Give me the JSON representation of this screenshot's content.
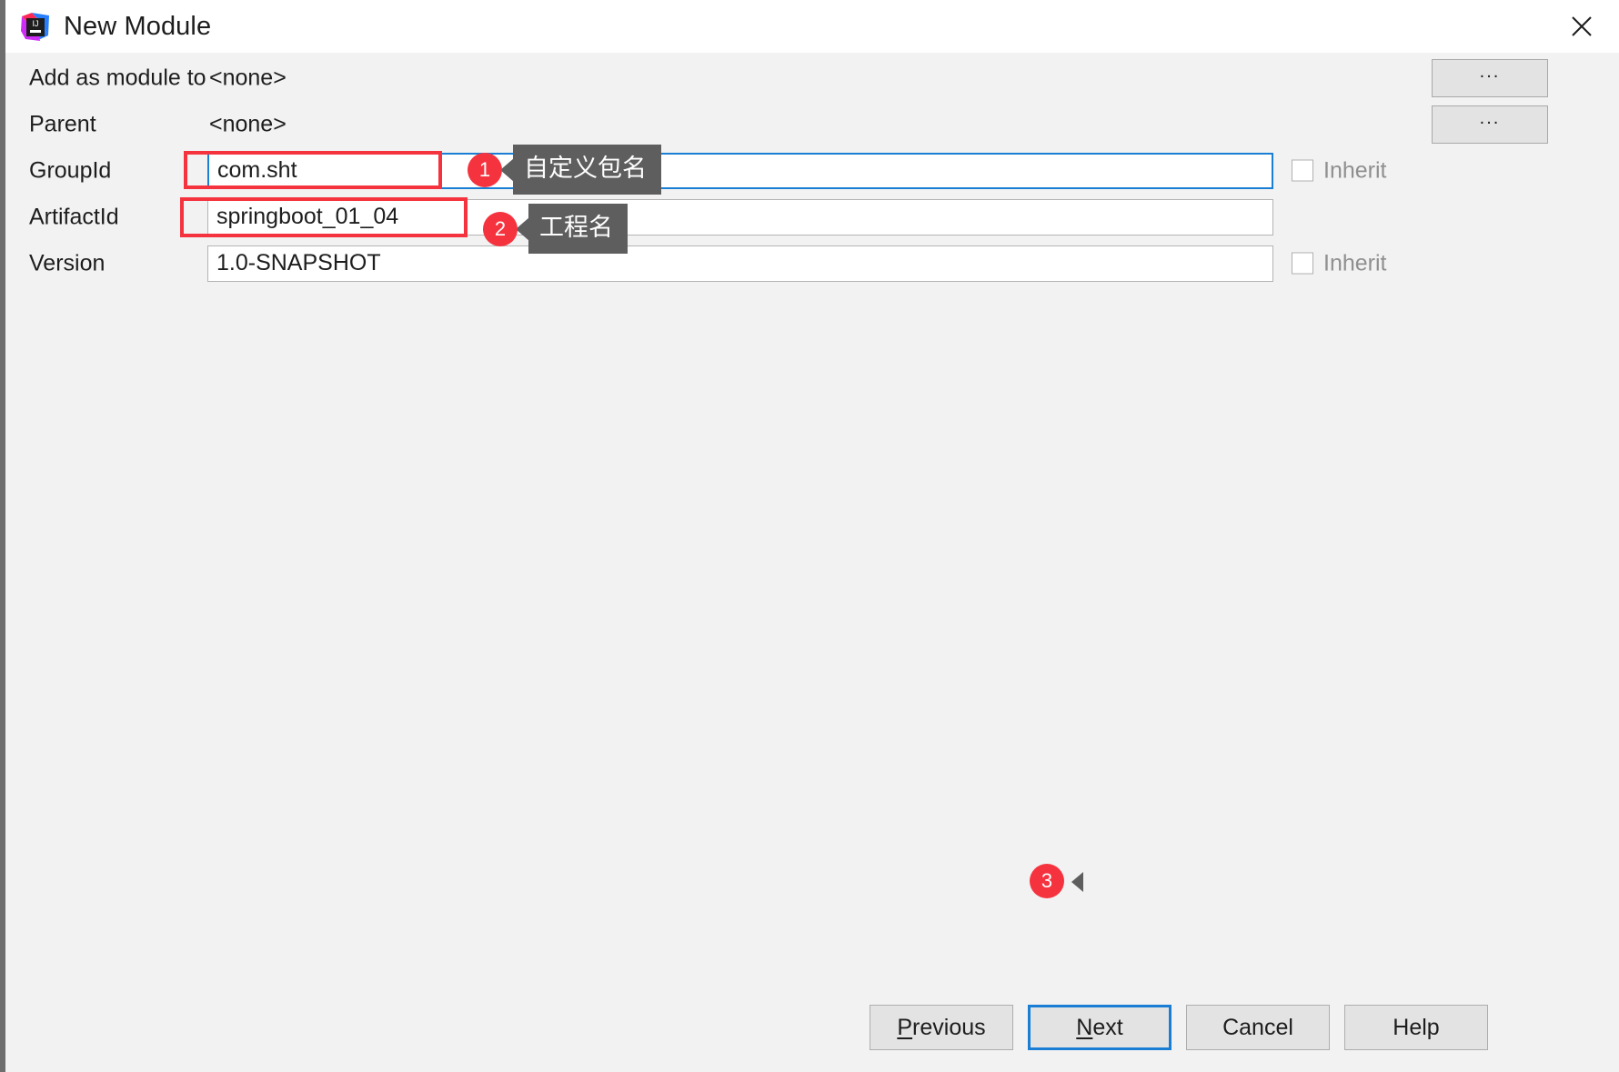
{
  "window": {
    "title": "New Module",
    "logo_icon": "intellij-idea-logo",
    "close_icon": "close-icon"
  },
  "form": {
    "rows": [
      {
        "label": "Add as module to",
        "type": "static",
        "value": "<none>",
        "button": "...",
        "name": "add-as-module-to"
      },
      {
        "label": "Parent",
        "type": "static",
        "value": "<none>",
        "button": "...",
        "name": "parent"
      },
      {
        "label": "GroupId",
        "type": "input",
        "value": "com.sht",
        "focused": true,
        "inherit_label": "Inherit",
        "inherit_checked": false,
        "name": "group-id"
      },
      {
        "label": "ArtifactId",
        "type": "input",
        "value": "springboot_01_04",
        "focused": false,
        "name": "artifact-id"
      },
      {
        "label": "Version",
        "type": "input",
        "value": "1.0-SNAPSHOT",
        "focused": false,
        "inherit_label": "Inherit",
        "inherit_checked": false,
        "name": "version"
      }
    ]
  },
  "annotations": [
    {
      "number": "1",
      "text": "自定义包名",
      "target": "group-id"
    },
    {
      "number": "2",
      "text": "工程名",
      "target": "artifact-id"
    },
    {
      "number": "3",
      "text": "",
      "target": "next-button"
    }
  ],
  "buttons": {
    "previous": "Previous",
    "previous_mnemonic": "P",
    "previous_rest": "revious",
    "next": "Next",
    "next_mnemonic": "N",
    "next_rest": "ext",
    "cancel": "Cancel",
    "help": "Help"
  },
  "colors": {
    "accent_blue": "#1a7fd4",
    "annotation_red": "#f5333f",
    "tooltip_gray": "#5e5e5e",
    "dialog_bg": "#f2f2f2"
  }
}
